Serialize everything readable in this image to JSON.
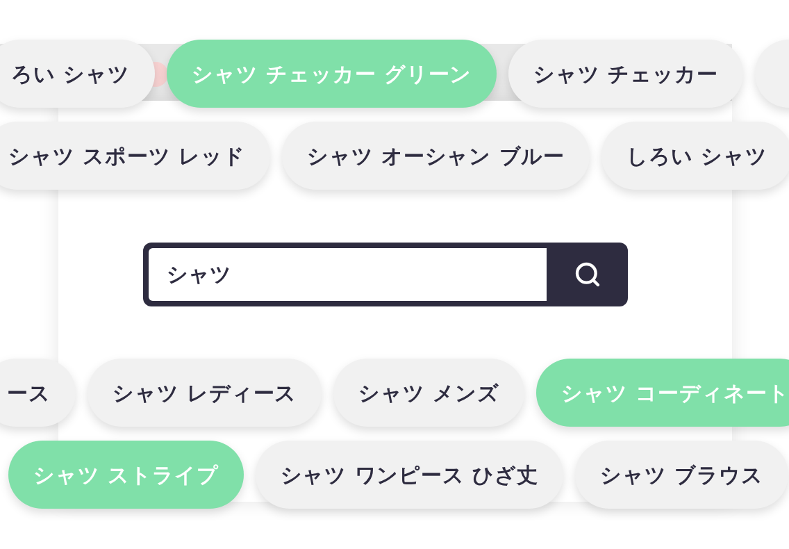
{
  "tag_rows_top": [
    {
      "tags": [
        {
          "label": "ろい シャツ",
          "selected": false
        },
        {
          "label": "シャツ チェッカー グリーン",
          "selected": true
        },
        {
          "label": "シャツ チェッカー",
          "selected": false
        },
        {
          "selected": false
        }
      ]
    },
    {
      "tags": [
        {
          "label": "シャツ スポーツ レッド",
          "selected": false
        },
        {
          "label": "シャツ オーシャン ブルー",
          "selected": false
        },
        {
          "label": "しろい シャツ",
          "selected": false
        }
      ]
    }
  ],
  "search": {
    "value": "シャツ"
  },
  "tag_rows_bottom": [
    {
      "tags": [
        {
          "label": "ース",
          "selected": false
        },
        {
          "label": "シャツ レディース",
          "selected": false
        },
        {
          "label": "シャツ メンズ",
          "selected": false
        },
        {
          "label": "シャツ コーディネート",
          "selected": true
        }
      ]
    },
    {
      "tags": [
        {
          "label": "シャツ ストライプ",
          "selected": true
        },
        {
          "label": "シャツ ワンピース ひざ丈",
          "selected": false
        },
        {
          "label": "シャツ ブラウス",
          "selected": false
        }
      ]
    }
  ]
}
